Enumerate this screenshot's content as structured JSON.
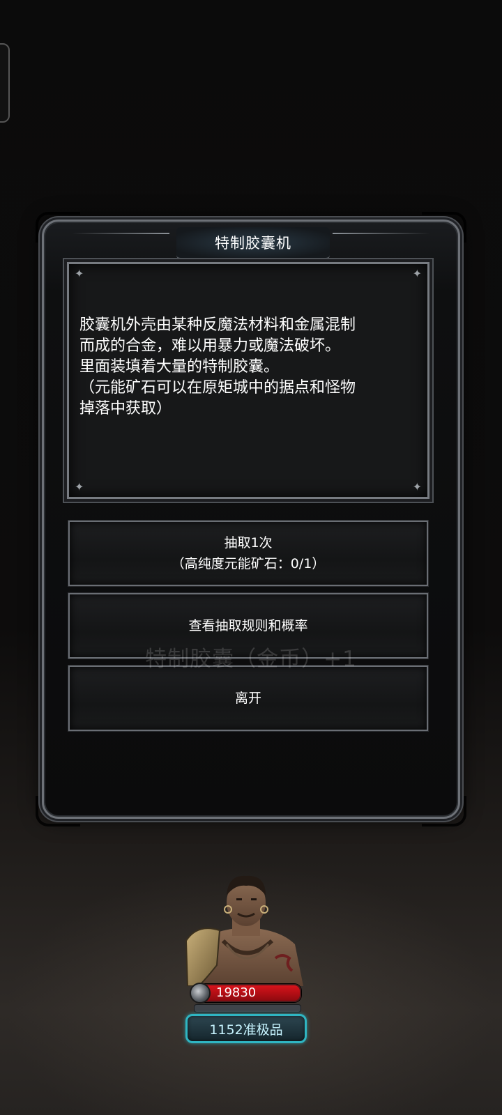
{
  "dialog": {
    "title": "特制胶囊机",
    "description": "胶囊机外壳由某种反魔法材料和金属混制\n而成的合金，难以用暴力或魔法破坏。\n里面装填着大量的特制胶囊。\n（元能矿石可以在原矩城中的据点和怪物\n掉落中获取）"
  },
  "buttons": {
    "draw_line1": "抽取1次",
    "draw_line2": "（高纯度元能矿石：0/1）",
    "rules": "查看抽取规则和概率",
    "leave": "离开"
  },
  "toast": {
    "text": "特制胶囊（金币）+1"
  },
  "character": {
    "hp_value": "19830",
    "grade": "1152准极品",
    "colors": {
      "hp_bar": "#d8131b",
      "grade_border": "#2fb5c2"
    }
  },
  "icons": [
    "sparkle-icon",
    "sword-icon",
    "character-portrait"
  ]
}
